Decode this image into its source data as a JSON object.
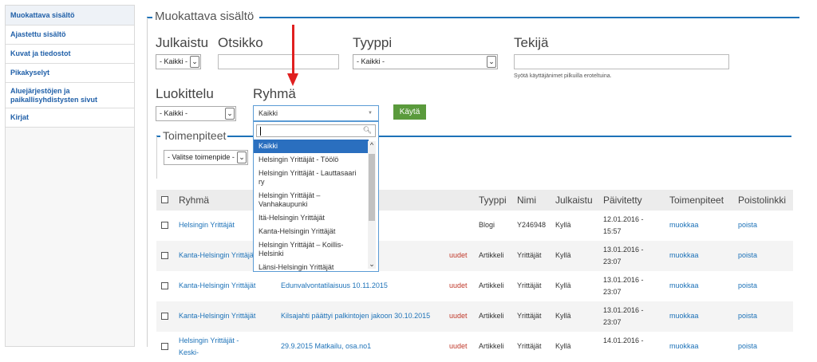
{
  "sidebar": {
    "items": [
      {
        "label": "Muokattava sisältö"
      },
      {
        "label": "Ajastettu sisältö"
      },
      {
        "label": "Kuvat ja tiedostot"
      },
      {
        "label": "Pikakyselyt"
      },
      {
        "label": "Aluejärjestöjen ja paikallisyhdistysten sivut"
      },
      {
        "label": "Kirjat"
      }
    ]
  },
  "filters": {
    "legend": "Muokattava sisältö",
    "published_label": "Julkaistu",
    "published_value": "- Kaikki -",
    "title_label": "Otsikko",
    "type_label": "Tyyppi",
    "type_value": "- Kaikki -",
    "author_label": "Tekijä",
    "author_hint": "Syötä käyttäjänimet pilkuilla eroteltuina.",
    "category_label": "Luokittelu",
    "category_value": "- Kaikki -",
    "group_label": "Ryhmä",
    "group_value": "Kaikki",
    "apply_label": "Käytä"
  },
  "group_dropdown": {
    "items": [
      "Kaikki",
      "Helsingin Yrittäjät - Töölö",
      "Helsingin Yrittäjät - Lauttasaari ry",
      "Helsingin Yrittäjät – Vanhakaupunki",
      "Itä-Helsingin Yrittäjät",
      "Kanta-Helsingin Yrittäjät",
      "Helsingin Yrittäjät – Koillis-Helsinki",
      "Länsi-Helsingin Yrittäjät"
    ],
    "highlighted": "Kaikki"
  },
  "actions": {
    "legend": "Toimenpiteet",
    "select_value": "- Valitse toimenpide -"
  },
  "table": {
    "headers": [
      "Ryhmä",
      "Tyyppi",
      "Nimi",
      "Julkaistu",
      "Päivitetty",
      "Toimenpiteet",
      "Poistolinkki"
    ],
    "rows": [
      {
        "group": "Helsingin Yrittäjät",
        "title": "",
        "new": "",
        "type": "Blogi",
        "name": "Y246948",
        "published": "Kyllä",
        "updated": "12.01.2016 - 15:57",
        "edit": "muokkaa",
        "delete": "poista"
      },
      {
        "group": "Kanta-Helsingin Yrittäjät",
        "title": "",
        "new": "uudet",
        "type": "Artikkeli",
        "name": "Yrittäjät",
        "published": "Kyllä",
        "updated": "13.01.2016 - 23:07",
        "edit": "muokkaa",
        "delete": "poista"
      },
      {
        "group": "Kanta-Helsingin Yrittäjät",
        "title": "Edunvalvontatilaisuus 10.11.2015",
        "new": "uudet",
        "type": "Artikkeli",
        "name": "Yrittäjät",
        "published": "Kyllä",
        "updated": "13.01.2016 - 23:07",
        "edit": "muokkaa",
        "delete": "poista"
      },
      {
        "group": "Kanta-Helsingin Yrittäjät",
        "title": "Kilsajahti päättyi palkintojen jakoon 30.10.2015",
        "new": "uudet",
        "type": "Artikkeli",
        "name": "Yrittäjät",
        "published": "Kyllä",
        "updated": "13.01.2016 - 23:07",
        "edit": "muokkaa",
        "delete": "poista"
      },
      {
        "group": "Helsingin Yrittäjät - Keski-",
        "title": "29.9.2015 Matkailu, osa.no1",
        "new": "uudet",
        "type": "Artikkeli",
        "name": "Yrittäjät",
        "published": "Kyllä",
        "updated": "14.01.2016 -",
        "edit": "muokkaa",
        "delete": "poista"
      }
    ]
  }
}
